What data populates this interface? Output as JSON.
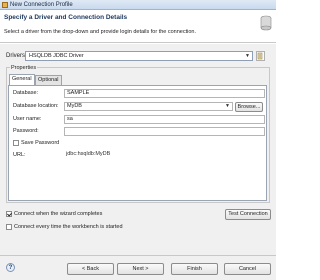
{
  "window": {
    "title": "New Connection Profile"
  },
  "header": {
    "title": "Specify a Driver and Connection Details",
    "description": "Select a driver from the drop-down and provide login details for the connection."
  },
  "drivers": {
    "label": "Drivers:",
    "selected": "HSQLDB JDBC Driver"
  },
  "properties": {
    "label": "Properties",
    "tabs": [
      "General",
      "Optional"
    ],
    "fields": {
      "database_label": "Database:",
      "database_value": "SAMPLE",
      "location_label": "Database location:",
      "location_value": "MyDB",
      "browse_label": "Browse...",
      "username_label": "User name:",
      "username_value": "sa",
      "password_label": "Password:",
      "password_value": "",
      "save_password_label": "Save Password",
      "url_label": "URL:",
      "url_value": "jdbc:hsqldb:MyDB"
    }
  },
  "options": {
    "connect_when_complete": {
      "label": "Connect when the wizard completes",
      "checked": true
    },
    "connect_on_startup": {
      "label": "Connect every time the workbench is started",
      "checked": false
    },
    "test_connection": "Test Connection"
  },
  "footer": {
    "help_symbol": "?",
    "back": "< Back",
    "next": "Next >",
    "finish": "Finish",
    "cancel": "Cancel"
  },
  "colors": {
    "title_blue": "#1f3a60",
    "panel_bg": "#f0f0f0"
  }
}
